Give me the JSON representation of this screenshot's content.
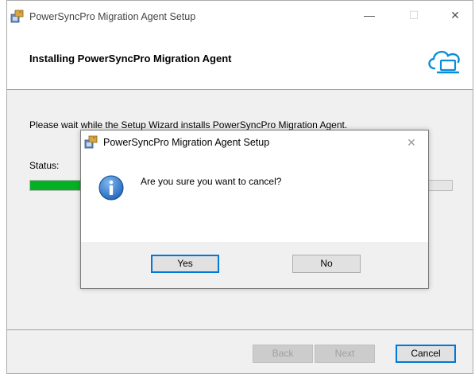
{
  "window": {
    "title": "PowerSyncPro Migration Agent Setup",
    "caption": {
      "minimize": "—",
      "maximize": "☐",
      "close": "✕"
    },
    "header_title": "Installing PowerSyncPro Migration Agent",
    "body_text": "Please wait while the Setup Wizard installs PowerSyncPro Migration Agent.",
    "status_label": "Status:",
    "progress": {
      "value": 0.3,
      "color": "#06b025"
    },
    "buttons": {
      "back": "Back",
      "next": "Next",
      "cancel": "Cancel"
    },
    "icons": {
      "app": "installer-icon",
      "header": "cloud-laptop-icon"
    }
  },
  "dialog": {
    "title": "PowerSyncPro Migration Agent Setup",
    "close": "✕",
    "message": "Are you sure you want to cancel?",
    "buttons": {
      "yes": "Yes",
      "no": "No"
    },
    "icon": "info-icon"
  }
}
